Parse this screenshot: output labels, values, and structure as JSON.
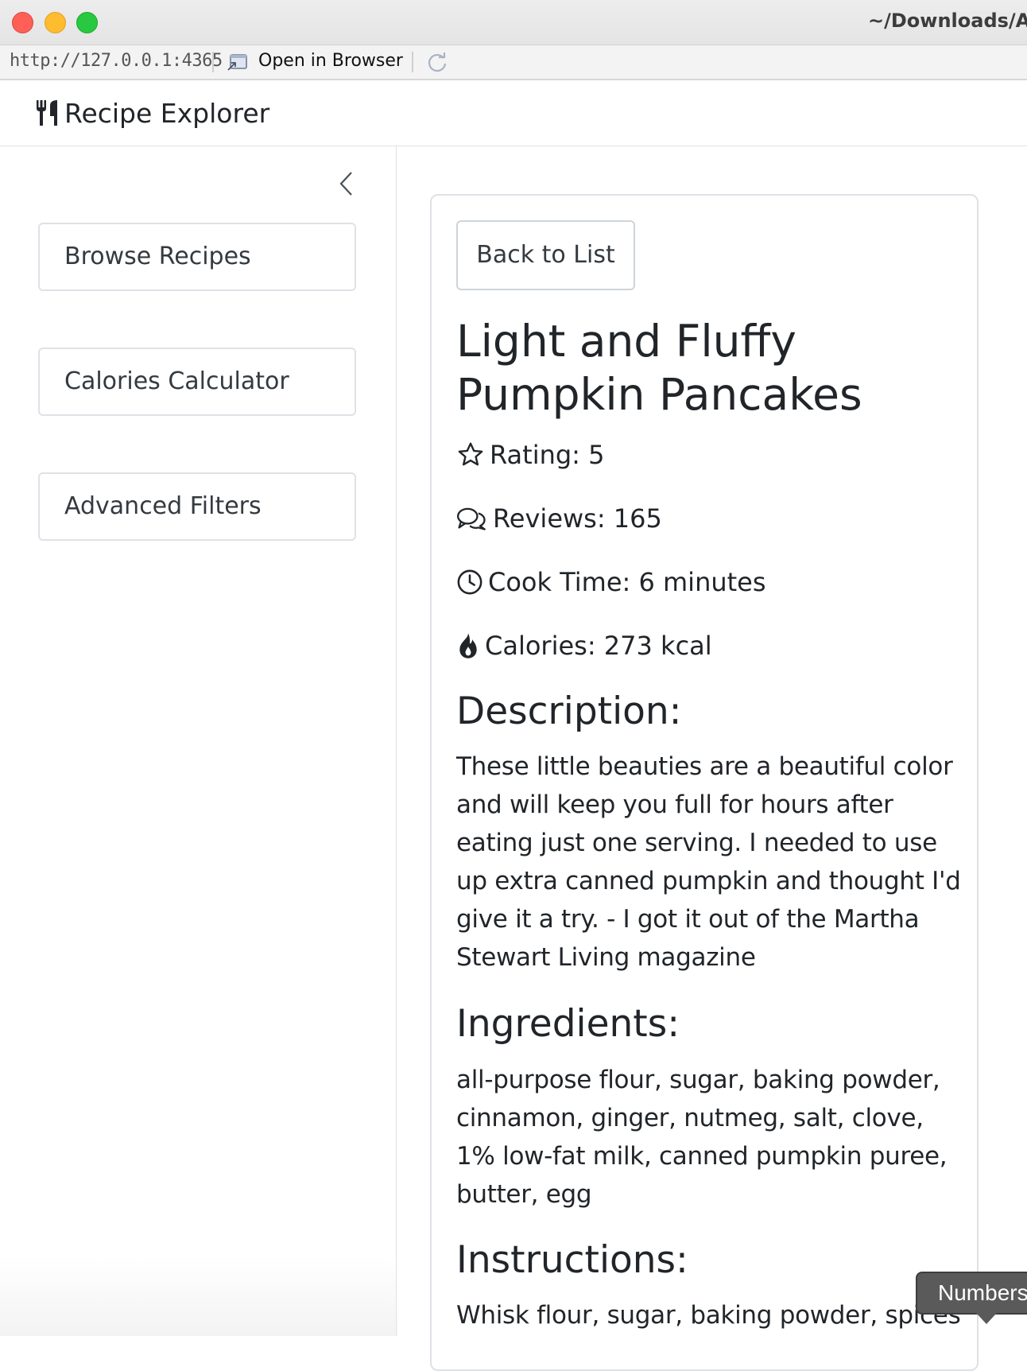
{
  "window": {
    "title": "~/Downloads/Ac"
  },
  "address_bar": {
    "url": "http://127.0.0.1:4365",
    "open_in_browser_label": "Open in Browser"
  },
  "navbar": {
    "brand": "Recipe Explorer",
    "brand_icon": "utensils-icon"
  },
  "sidebar": {
    "items": [
      {
        "label": "Browse Recipes"
      },
      {
        "label": "Calories Calculator"
      },
      {
        "label": "Advanced Filters"
      }
    ]
  },
  "recipe": {
    "back_label": "Back to List",
    "title": "Light and Fluffy Pumpkin Pancakes",
    "rating": "Rating: 5",
    "reviews": "Reviews: 165",
    "cook_time": "Cook Time: 6 minutes",
    "calories": "Calories: 273 kcal",
    "description_heading": "Description:",
    "description": "These little beauties are a beautiful color and will keep you full for hours after eating just one serving. I needed to use up extra canned pumpkin and thought I'd give it a try. - I got it out of the Martha Stewart Living magazine",
    "ingredients_heading": "Ingredients:",
    "ingredients": "all-purpose flour, sugar, baking powder, cinnamon, ginger, nutmeg, salt, clove, 1% low-fat milk, canned pumpkin puree, butter, egg",
    "instructions_heading": "Instructions:",
    "instructions_start": "Whisk flour, sugar, baking powder, spices"
  },
  "tooltip": {
    "text": "Numbers"
  }
}
